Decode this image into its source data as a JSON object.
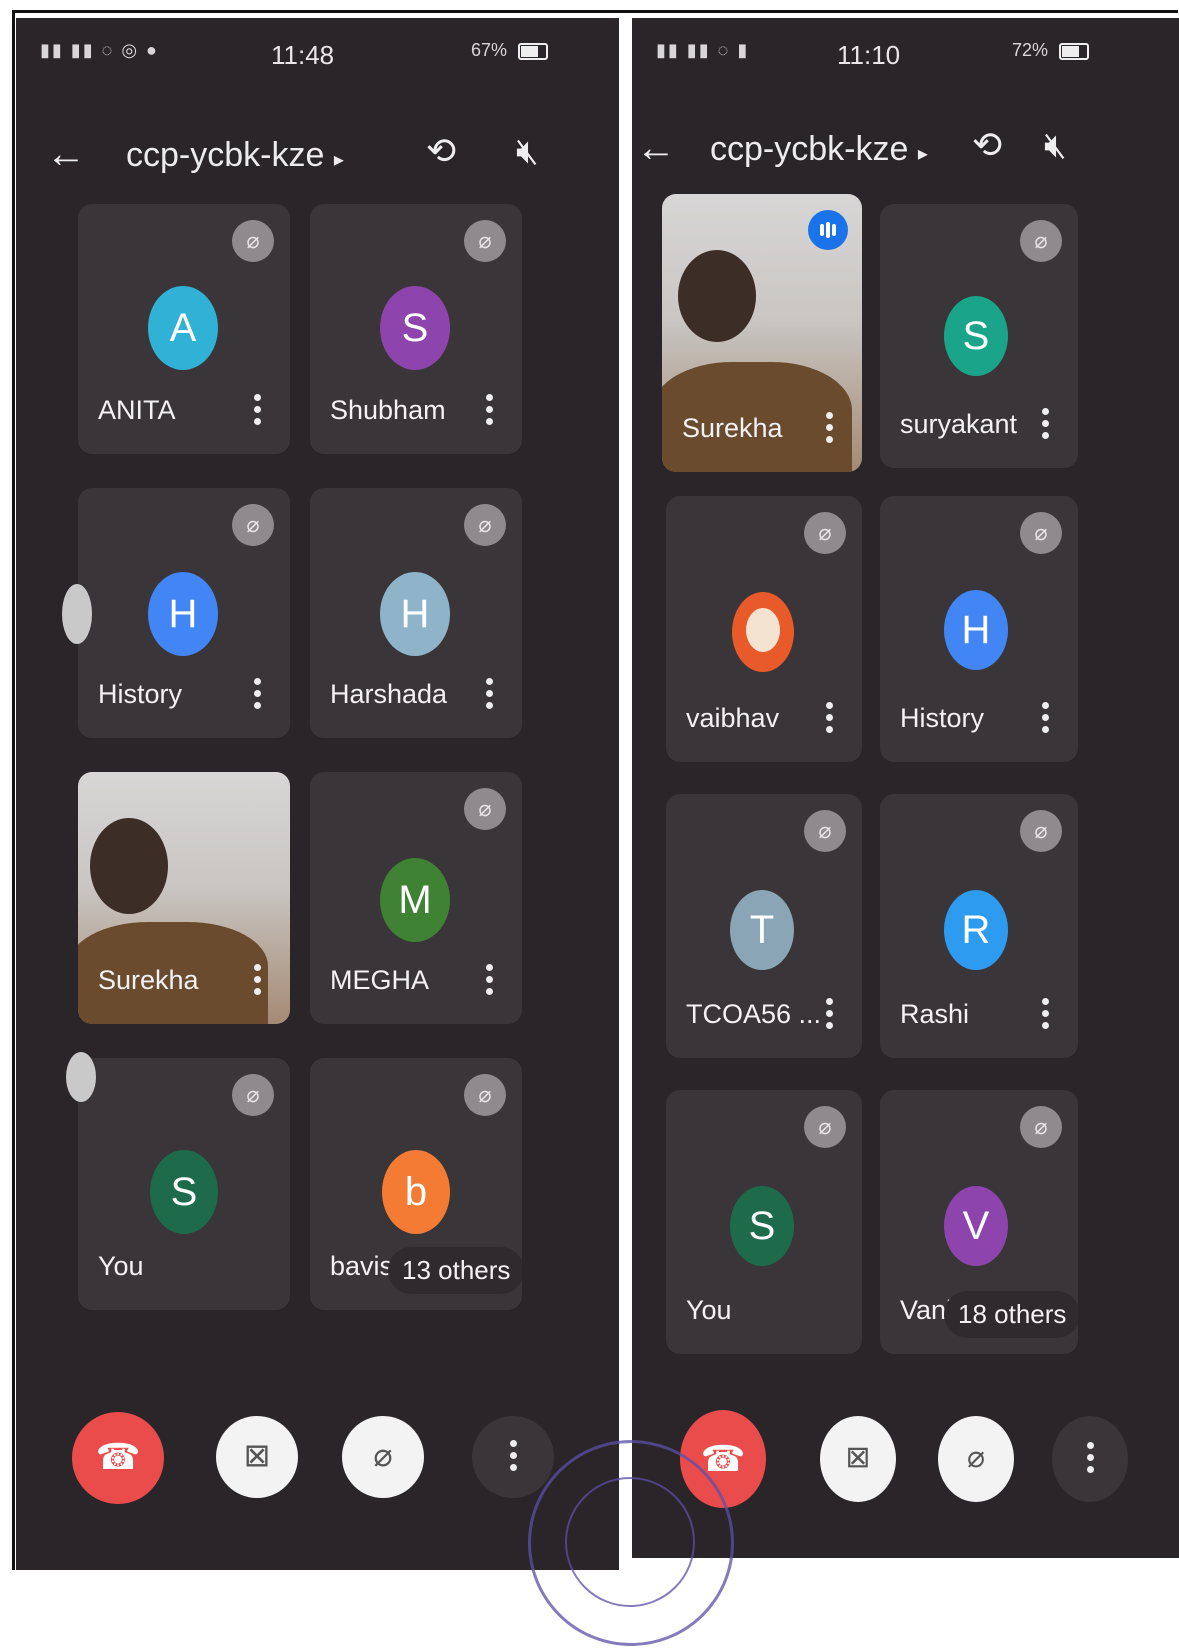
{
  "colors": {
    "background": "#2a2529",
    "tile": "#3a3538",
    "end_call": "#ea4c4c",
    "speaking": "#1a73e8"
  },
  "left_screen": {
    "status": {
      "time": "11:48",
      "battery": "67%"
    },
    "meeting_code": "ccp-ycbk-kze",
    "participants": [
      {
        "name": "ANITA",
        "initial": "A",
        "avatar_color": "#2fb2d6",
        "muted": true
      },
      {
        "name": "Shubham",
        "initial": "S",
        "avatar_color": "#8e44ad",
        "muted": true
      },
      {
        "name": "History",
        "initial": "H",
        "avatar_color": "#4285f4",
        "muted": true
      },
      {
        "name": "Harshada",
        "initial": "H",
        "avatar_color": "#8fb4c9",
        "muted": true
      },
      {
        "name": "Surekha",
        "video": true
      },
      {
        "name": "MEGHA",
        "initial": "M",
        "avatar_color": "#3f8233",
        "muted": true
      },
      {
        "name": "You",
        "initial": "S",
        "avatar_color": "#1e6b4c",
        "muted": true
      },
      {
        "name": "bavis",
        "initial": "b",
        "avatar_color": "#f47b33",
        "muted": true
      }
    ],
    "others": "13 others"
  },
  "right_screen": {
    "status": {
      "time": "11:10",
      "battery": "72%"
    },
    "meeting_code": "ccp-ycbk-kze",
    "participants": [
      {
        "name": "Surekha",
        "video": true,
        "speaking": true
      },
      {
        "name": "suryakant",
        "initial": "S",
        "avatar_color": "#1aa58a",
        "muted": true
      },
      {
        "name": "vaibhav",
        "avatar_image": true,
        "muted": true
      },
      {
        "name": "History",
        "initial": "H",
        "avatar_color": "#4285f4",
        "muted": true
      },
      {
        "name": "TCOA56 ...",
        "initial": "T",
        "avatar_color": "#8aa6b6",
        "muted": true
      },
      {
        "name": "Rashi",
        "initial": "R",
        "avatar_color": "#2d9cf0",
        "muted": true
      },
      {
        "name": "You",
        "initial": "S",
        "avatar_color": "#1e6b4c",
        "muted": true
      },
      {
        "name": "Vanit",
        "initial": "V",
        "avatar_color": "#8e44ad",
        "muted": true
      }
    ],
    "others": "18 others"
  },
  "icons": {
    "back": "arrow-left-icon",
    "switch_camera": "switch-camera-icon",
    "speaker_off": "speaker-off-icon",
    "mic_off": "mic-off-icon",
    "more": "more-vertical-icon",
    "end_call": "end-call-icon",
    "camera_off": "camera-off-icon"
  }
}
